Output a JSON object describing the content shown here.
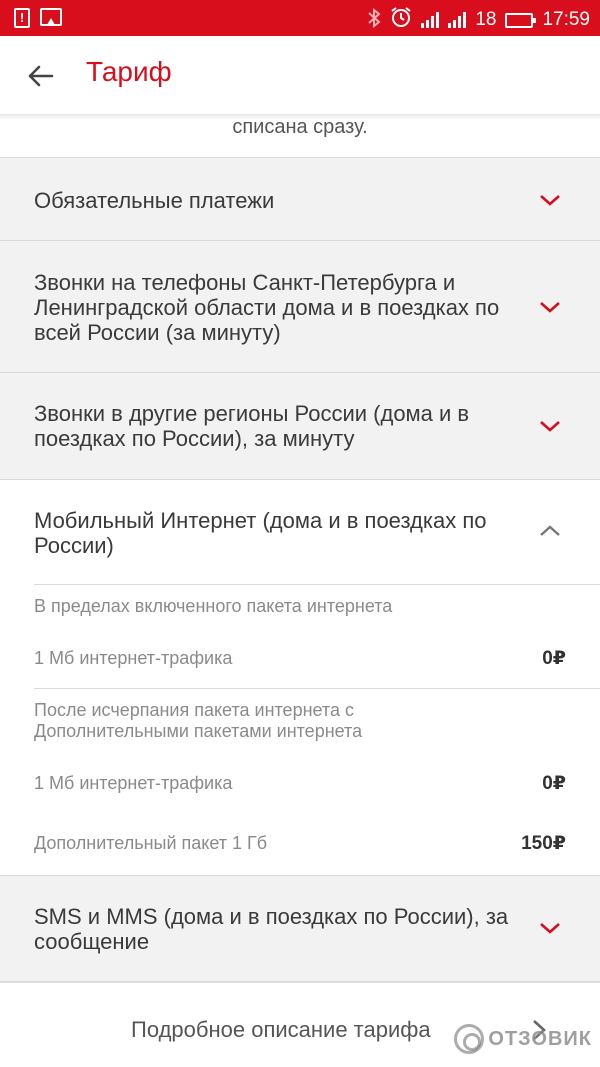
{
  "status_bar": {
    "battery_level": "18",
    "time": "17:59",
    "left_icons": [
      "alert-icon",
      "image-icon"
    ],
    "right_icons": [
      "bluetooth-icon",
      "alarm-icon",
      "signal-icon",
      "battery-icon"
    ]
  },
  "app_bar": {
    "title": "Тариф",
    "back_icon": "arrow-left-icon"
  },
  "fragment_text": "списана сразу.",
  "colors": {
    "accent": "#d80e1c",
    "section_bg": "#f2f2f2"
  },
  "sections": [
    {
      "title": "Обязательные платежи",
      "expanded": false
    },
    {
      "title": "Звонки на телефоны Санкт-Петербурга и Ленинградской области дома и в поездках по всей России (за минуту)",
      "expanded": false
    },
    {
      "title": "Звонки в другие регионы России (дома и в поездках по России), за минуту",
      "expanded": false
    },
    {
      "title": "Мобильный Интернет (дома и в поездках по России)",
      "expanded": true,
      "groups": [
        {
          "header": "В пределах включенного пакета интернета",
          "rows": [
            {
              "label": "1 Мб интернет-трафика",
              "value": "0₽"
            }
          ]
        },
        {
          "header": "После исчерпания пакета интернета с Дополнительными пакетами интернета",
          "rows": [
            {
              "label": "1 Мб интернет-трафика",
              "value": "0₽"
            },
            {
              "label": "Дополнительный пакет 1 Гб",
              "value": "150₽"
            }
          ]
        }
      ]
    },
    {
      "title": "SMS и MMS (дома и в поездках по России), за сообщение",
      "expanded": false
    }
  ],
  "details_link": "Подробное описание тарифа",
  "watermark": "ОТЗОВИК"
}
